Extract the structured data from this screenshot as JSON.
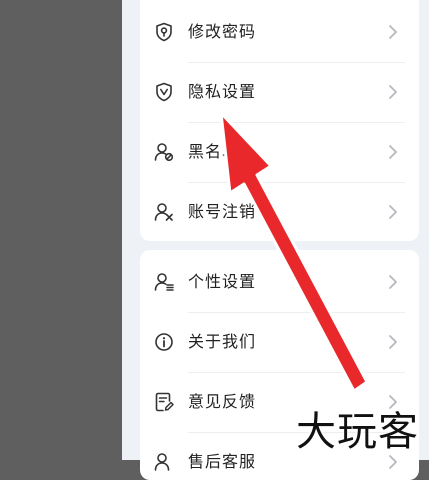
{
  "settings": {
    "group1": [
      {
        "label": "修改密码",
        "icon": "lock-shield-icon"
      },
      {
        "label": "隐私设置",
        "icon": "privacy-shield-icon"
      },
      {
        "label": "黑名单",
        "icon": "user-block-icon"
      },
      {
        "label": "账号注销",
        "icon": "user-remove-icon"
      }
    ],
    "group2": [
      {
        "label": "个性设置",
        "icon": "user-settings-icon"
      },
      {
        "label": "关于我们",
        "icon": "info-icon"
      },
      {
        "label": "意见反馈",
        "icon": "feedback-icon"
      },
      {
        "label": "售后客服",
        "icon": "support-icon"
      }
    ]
  },
  "watermark": {
    "text": "大玩客"
  },
  "annotation": {
    "color": "#e8282b"
  }
}
